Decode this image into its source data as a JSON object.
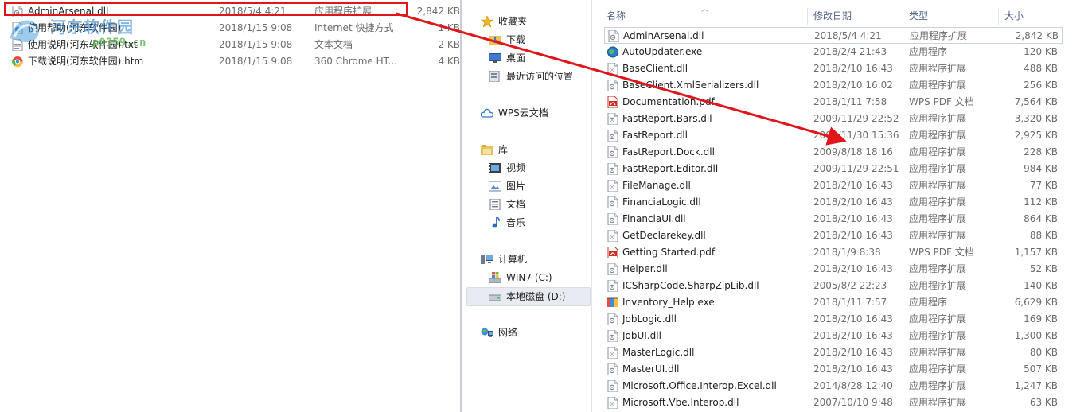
{
  "colors": {
    "annotation_red": "#e0161a",
    "header_text": "#4d6185",
    "secondary_text": "#6d6d6d"
  },
  "watermark": {
    "title": "河东软件园",
    "url": "p0359.cn"
  },
  "left_files": [
    {
      "name": "AdminArsenal.dll",
      "date": "2018/5/4 4:21",
      "type": "应用程序扩展",
      "size": "2,842 KB",
      "icon": "dll-icon"
    },
    {
      "name": "使用帮助(河东软件园)",
      "date": "2018/1/15 9:08",
      "type": "Internet 快捷方式",
      "size": "1 KB",
      "icon": "url-shortcut-icon"
    },
    {
      "name": "使用说明(河东软件园).txt",
      "date": "2018/1/15 9:08",
      "type": "文本文档",
      "size": "2 KB",
      "icon": "txt-icon"
    },
    {
      "name": "下载说明(河东软件园).htm",
      "date": "2018/1/15 9:08",
      "type": "360 Chrome HT...",
      "size": "4 KB",
      "icon": "chrome-htm-icon"
    }
  ],
  "nav": {
    "favorites": "收藏夹",
    "downloads": "下载",
    "desktop": "桌面",
    "recent": "最近访问的位置",
    "wps_cloud": "WPS云文档",
    "libraries": "库",
    "videos": "视频",
    "pictures": "图片",
    "documents": "文档",
    "music": "音乐",
    "computer": "计算机",
    "drive_c": "WIN7 (C:)",
    "drive_d": "本地磁盘 (D:)",
    "network": "网络"
  },
  "columns": {
    "name": "名称",
    "modified": "修改日期",
    "type": "类型",
    "size": "大小"
  },
  "files": [
    {
      "name": "AdminArsenal.dll",
      "date": "2018/5/4 4:21",
      "type": "应用程序扩展",
      "size": "2,842 KB",
      "icon": "dll-icon"
    },
    {
      "name": "AutoUpdater.exe",
      "date": "2018/2/4 21:43",
      "type": "应用程序",
      "size": "120 KB",
      "icon": "globe-exe-icon"
    },
    {
      "name": "BaseClient.dll",
      "date": "2018/2/10 16:43",
      "type": "应用程序扩展",
      "size": "488 KB",
      "icon": "dll-icon"
    },
    {
      "name": "BaseClient.XmlSerializers.dll",
      "date": "2018/2/10 16:02",
      "type": "应用程序扩展",
      "size": "256 KB",
      "icon": "dll-icon"
    },
    {
      "name": "Documentation.pdf",
      "date": "2018/1/11 7:58",
      "type": "WPS PDF 文档",
      "size": "7,564 KB",
      "icon": "pdf-icon"
    },
    {
      "name": "FastReport.Bars.dll",
      "date": "2009/11/29 22:52",
      "type": "应用程序扩展",
      "size": "3,320 KB",
      "icon": "dll-icon"
    },
    {
      "name": "FastReport.dll",
      "date": "2009/11/30 15:36",
      "type": "应用程序扩展",
      "size": "2,925 KB",
      "icon": "dll-icon"
    },
    {
      "name": "FastReport.Dock.dll",
      "date": "2009/8/18 18:16",
      "type": "应用程序扩展",
      "size": "228 KB",
      "icon": "dll-icon"
    },
    {
      "name": "FastReport.Editor.dll",
      "date": "2009/11/29 22:51",
      "type": "应用程序扩展",
      "size": "984 KB",
      "icon": "dll-icon"
    },
    {
      "name": "FileManage.dll",
      "date": "2018/2/10 16:43",
      "type": "应用程序扩展",
      "size": "77 KB",
      "icon": "dll-icon"
    },
    {
      "name": "FinanciaLogic.dll",
      "date": "2018/2/10 16:43",
      "type": "应用程序扩展",
      "size": "112 KB",
      "icon": "dll-icon"
    },
    {
      "name": "FinanciaUI.dll",
      "date": "2018/2/10 16:43",
      "type": "应用程序扩展",
      "size": "864 KB",
      "icon": "dll-icon"
    },
    {
      "name": "GetDeclarekey.dll",
      "date": "2018/2/10 16:43",
      "type": "应用程序扩展",
      "size": "88 KB",
      "icon": "dll-icon"
    },
    {
      "name": "Getting Started.pdf",
      "date": "2018/1/9 8:38",
      "type": "WPS PDF 文档",
      "size": "1,157 KB",
      "icon": "pdf-icon"
    },
    {
      "name": "Helper.dll",
      "date": "2018/2/10 16:43",
      "type": "应用程序扩展",
      "size": "52 KB",
      "icon": "dll-icon"
    },
    {
      "name": "ICSharpCode.SharpZipLib.dll",
      "date": "2005/8/2 22:23",
      "type": "应用程序扩展",
      "size": "140 KB",
      "icon": "dll-icon"
    },
    {
      "name": "Inventory_Help.exe",
      "date": "2018/1/11 7:57",
      "type": "应用程序",
      "size": "6,629 KB",
      "icon": "help-exe-icon"
    },
    {
      "name": "JobLogic.dll",
      "date": "2018/2/10 16:43",
      "type": "应用程序扩展",
      "size": "169 KB",
      "icon": "dll-icon"
    },
    {
      "name": "JobUI.dll",
      "date": "2018/2/10 16:43",
      "type": "应用程序扩展",
      "size": "1,300 KB",
      "icon": "dll-icon"
    },
    {
      "name": "MasterLogic.dll",
      "date": "2018/2/10 16:43",
      "type": "应用程序扩展",
      "size": "80 KB",
      "icon": "dll-icon"
    },
    {
      "name": "MasterUI.dll",
      "date": "2018/2/10 16:43",
      "type": "应用程序扩展",
      "size": "507 KB",
      "icon": "dll-icon"
    },
    {
      "name": "Microsoft.Office.Interop.Excel.dll",
      "date": "2014/8/28 12:40",
      "type": "应用程序扩展",
      "size": "1,247 KB",
      "icon": "dll-icon"
    },
    {
      "name": "Microsoft.Vbe.Interop.dll",
      "date": "2007/10/10 9:48",
      "type": "应用程序扩展",
      "size": "63 KB",
      "icon": "dll-icon"
    }
  ]
}
